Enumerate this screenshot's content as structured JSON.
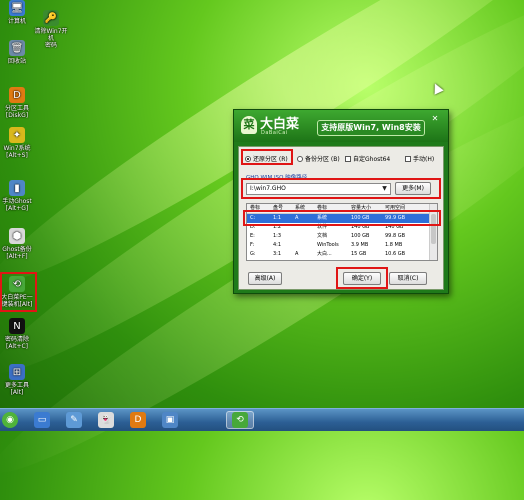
{
  "desktop": {
    "icons": [
      {
        "name": "computer",
        "label": "计算机",
        "glyph": "🖥",
        "color": "#3b7bd1"
      },
      {
        "name": "win7-pw-tool",
        "label": "清除Win7开机\n密码",
        "glyph": "🔑",
        "color": "#3a8c2e"
      },
      {
        "name": "recycle-bin",
        "label": "回收站",
        "glyph": "🗑",
        "color": "#6c8aa8"
      },
      {
        "name": "partition-tool",
        "label": "分区工具\n[DiskG]",
        "glyph": "D",
        "color": "#e07a12"
      },
      {
        "name": "pe-tool",
        "label": "Win7系统\n[Alt+S]",
        "glyph": "✦",
        "color": "#d9b81c"
      },
      {
        "name": "system-install",
        "label": "手动Ghost\n[Alt+G]",
        "glyph": "▮",
        "color": "#4f86c6"
      },
      {
        "name": "ghost-backup",
        "label": "Ghost备份\n[Alt+F]",
        "glyph": "⬢",
        "color": "#d8d8d8"
      },
      {
        "name": "onekey-install",
        "label": "大白菜PE一\n键装机[Alt]",
        "glyph": "⟲",
        "color": "#47a83a"
      },
      {
        "name": "password-tool",
        "label": "密码清除\n[Alt+C]",
        "glyph": "N",
        "color": "#111111"
      },
      {
        "name": "more-tools",
        "label": "更多工具\n[Alt]",
        "glyph": "⊞",
        "color": "#3b6fc4"
      }
    ]
  },
  "dialog": {
    "logo_title": "大白菜",
    "logo_sub": "DaBaiCai",
    "banner": "支持原版Win7, Win8安装",
    "close_label": "✕",
    "radio_options": [
      {
        "label": "还原分区 (R)",
        "selected": true
      },
      {
        "label": "备份分区 (B)",
        "selected": false
      }
    ],
    "check_options": [
      {
        "label": "自定Ghost64",
        "checked": false
      },
      {
        "label": "手动(H)",
        "checked": false
      }
    ],
    "path_label": "GHO WIM ISO 映像路径",
    "path_value": "I:\\win7.GHO",
    "more_button": "更多(M)",
    "table": {
      "headers": [
        "卷标",
        "盘号",
        "系统",
        "卷标",
        "容量大小",
        "可用空间"
      ],
      "rows": [
        [
          "C:",
          "1:1",
          "A",
          "系统",
          "100 GB",
          "99.9 GB"
        ],
        [
          "D:",
          "1:2",
          "",
          "软件",
          "140 GB",
          "140 GB"
        ],
        [
          "E:",
          "1:3",
          "",
          "文档",
          "100 GB",
          "99.8 GB"
        ],
        [
          "F:",
          "4:1",
          "",
          "WinTools",
          "3.9 MB",
          "1.8 MB"
        ],
        [
          "G:",
          "3:1",
          "A",
          "大白...",
          "15 GB",
          "10.6 GB"
        ]
      ],
      "selected_row": 0
    },
    "advanced_button": "高级(A)",
    "ok_button": "确定(Y)",
    "cancel_button": "取消(C)"
  },
  "taskbar": {
    "items": [
      {
        "name": "start-orb",
        "glyph": "◉",
        "color": "#4fb33a"
      },
      {
        "name": "computer-taskbar",
        "glyph": "▭",
        "color": "#3b7bd1"
      },
      {
        "name": "tools-taskbar",
        "glyph": "✎",
        "color": "#5e9ad6"
      },
      {
        "name": "ghost-taskbar",
        "glyph": "👻",
        "color": "#dcdcdc"
      },
      {
        "name": "partition-taskbar",
        "glyph": "D",
        "color": "#e07a12"
      },
      {
        "name": "cmd-taskbar",
        "glyph": "▣",
        "color": "#4f86c6"
      },
      {
        "name": "onekey-taskbar",
        "glyph": "⟲",
        "color": "#47a83a"
      }
    ]
  }
}
